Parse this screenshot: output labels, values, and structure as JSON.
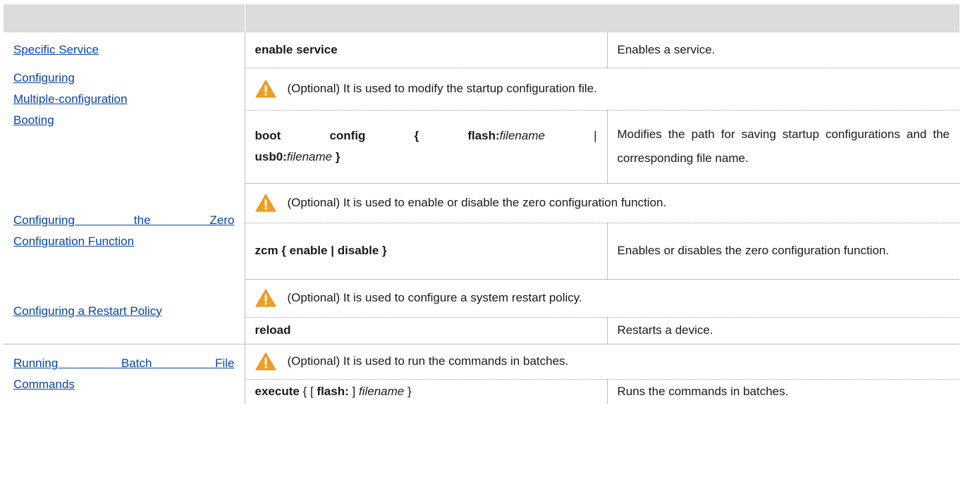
{
  "header": {
    "col_task": "",
    "col_command": ""
  },
  "rows": {
    "enable": {
      "task": "Specific Service",
      "command": "enable service",
      "desc": "Enables a service."
    },
    "boot": {
      "task_lines": [
        "Configuring",
        "Multiple-configuration",
        "Booting"
      ],
      "note": "(Optional) It is used to modify the startup configuration file.",
      "cmd_line1": {
        "kw1": "boot",
        "kw2": "config",
        "brace_open": "{",
        "kw3": "flash:",
        "arg1": "filename",
        "pipe": "|"
      },
      "cmd_line2": {
        "kw4": "usb0:",
        "arg2": "filename",
        "brace_close": "}"
      },
      "desc": "Modifies the path for saving startup configurations and the corresponding file name."
    },
    "zcm": {
      "task_line1": [
        "Configuring",
        "the",
        "Zero"
      ],
      "task_line2": "Configuration Function",
      "note": "(Optional) It is used to enable or disable the zero configuration function.",
      "command": "zcm { enable | disable }",
      "desc": "Enables or disables the zero configuration function."
    },
    "reload": {
      "task": "Configuring a Restart Policy",
      "note": "(Optional) It is used to configure a system restart policy.",
      "command": "reload",
      "desc": "Restarts a device."
    },
    "execute": {
      "task_line1": [
        "Running",
        "Batch",
        "File"
      ],
      "task_line2": "Commands",
      "note": "(Optional) It is used to run the commands in batches.",
      "cmd": {
        "kw1": "execute",
        "brace_open": "{ [",
        "kw2": "flash:",
        "bracket_close": "]",
        "arg": "filename",
        "brace_close": "}"
      },
      "desc": "Runs the commands in batches."
    }
  },
  "icons": {
    "warning": "warning-triangle-icon",
    "warning_color": "#f0a020"
  }
}
